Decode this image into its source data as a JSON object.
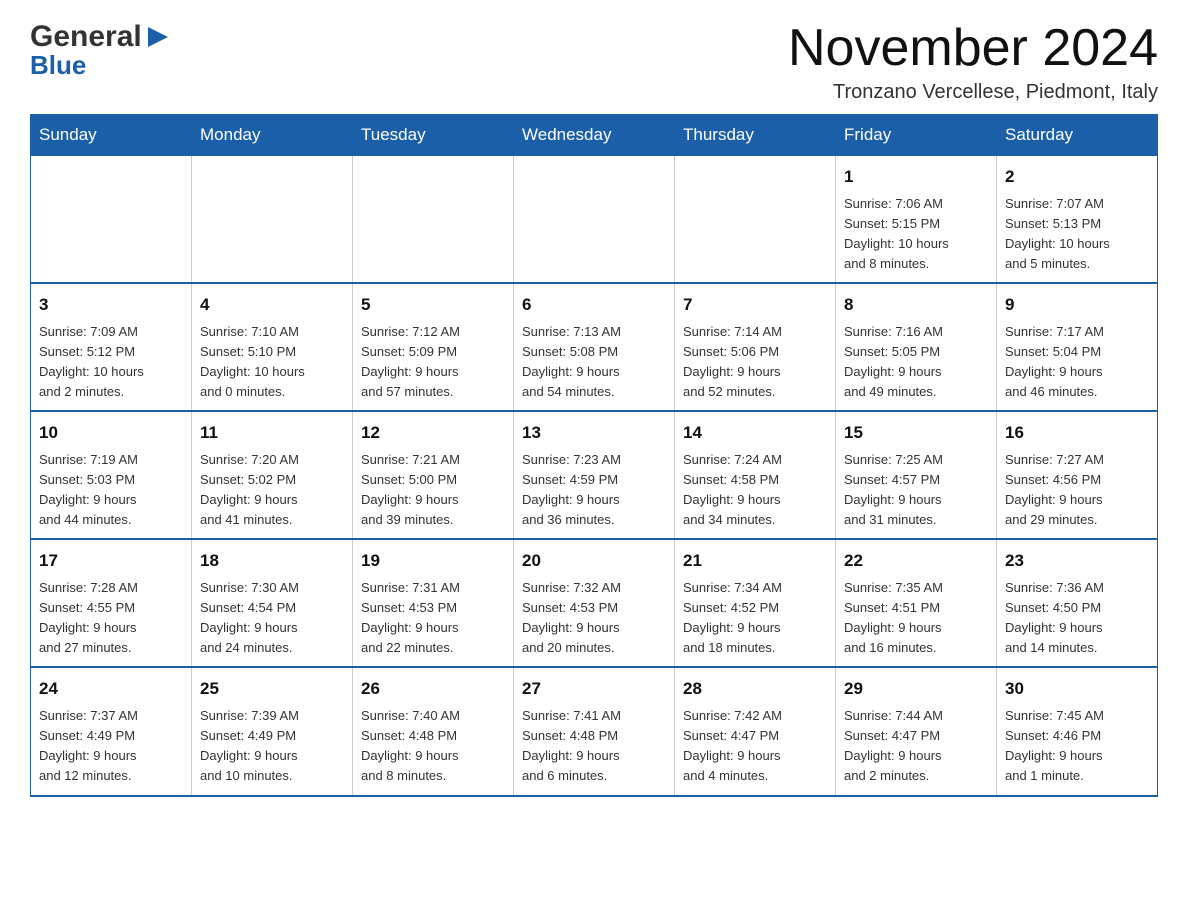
{
  "header": {
    "logo_general": "General",
    "logo_blue": "Blue",
    "month_title": "November 2024",
    "location": "Tronzano Vercellese, Piedmont, Italy"
  },
  "days_of_week": [
    "Sunday",
    "Monday",
    "Tuesday",
    "Wednesday",
    "Thursday",
    "Friday",
    "Saturday"
  ],
  "weeks": [
    {
      "cells": [
        {
          "day": "",
          "info": ""
        },
        {
          "day": "",
          "info": ""
        },
        {
          "day": "",
          "info": ""
        },
        {
          "day": "",
          "info": ""
        },
        {
          "day": "",
          "info": ""
        },
        {
          "day": "1",
          "info": "Sunrise: 7:06 AM\nSunset: 5:15 PM\nDaylight: 10 hours\nand 8 minutes."
        },
        {
          "day": "2",
          "info": "Sunrise: 7:07 AM\nSunset: 5:13 PM\nDaylight: 10 hours\nand 5 minutes."
        }
      ]
    },
    {
      "cells": [
        {
          "day": "3",
          "info": "Sunrise: 7:09 AM\nSunset: 5:12 PM\nDaylight: 10 hours\nand 2 minutes."
        },
        {
          "day": "4",
          "info": "Sunrise: 7:10 AM\nSunset: 5:10 PM\nDaylight: 10 hours\nand 0 minutes."
        },
        {
          "day": "5",
          "info": "Sunrise: 7:12 AM\nSunset: 5:09 PM\nDaylight: 9 hours\nand 57 minutes."
        },
        {
          "day": "6",
          "info": "Sunrise: 7:13 AM\nSunset: 5:08 PM\nDaylight: 9 hours\nand 54 minutes."
        },
        {
          "day": "7",
          "info": "Sunrise: 7:14 AM\nSunset: 5:06 PM\nDaylight: 9 hours\nand 52 minutes."
        },
        {
          "day": "8",
          "info": "Sunrise: 7:16 AM\nSunset: 5:05 PM\nDaylight: 9 hours\nand 49 minutes."
        },
        {
          "day": "9",
          "info": "Sunrise: 7:17 AM\nSunset: 5:04 PM\nDaylight: 9 hours\nand 46 minutes."
        }
      ]
    },
    {
      "cells": [
        {
          "day": "10",
          "info": "Sunrise: 7:19 AM\nSunset: 5:03 PM\nDaylight: 9 hours\nand 44 minutes."
        },
        {
          "day": "11",
          "info": "Sunrise: 7:20 AM\nSunset: 5:02 PM\nDaylight: 9 hours\nand 41 minutes."
        },
        {
          "day": "12",
          "info": "Sunrise: 7:21 AM\nSunset: 5:00 PM\nDaylight: 9 hours\nand 39 minutes."
        },
        {
          "day": "13",
          "info": "Sunrise: 7:23 AM\nSunset: 4:59 PM\nDaylight: 9 hours\nand 36 minutes."
        },
        {
          "day": "14",
          "info": "Sunrise: 7:24 AM\nSunset: 4:58 PM\nDaylight: 9 hours\nand 34 minutes."
        },
        {
          "day": "15",
          "info": "Sunrise: 7:25 AM\nSunset: 4:57 PM\nDaylight: 9 hours\nand 31 minutes."
        },
        {
          "day": "16",
          "info": "Sunrise: 7:27 AM\nSunset: 4:56 PM\nDaylight: 9 hours\nand 29 minutes."
        }
      ]
    },
    {
      "cells": [
        {
          "day": "17",
          "info": "Sunrise: 7:28 AM\nSunset: 4:55 PM\nDaylight: 9 hours\nand 27 minutes."
        },
        {
          "day": "18",
          "info": "Sunrise: 7:30 AM\nSunset: 4:54 PM\nDaylight: 9 hours\nand 24 minutes."
        },
        {
          "day": "19",
          "info": "Sunrise: 7:31 AM\nSunset: 4:53 PM\nDaylight: 9 hours\nand 22 minutes."
        },
        {
          "day": "20",
          "info": "Sunrise: 7:32 AM\nSunset: 4:53 PM\nDaylight: 9 hours\nand 20 minutes."
        },
        {
          "day": "21",
          "info": "Sunrise: 7:34 AM\nSunset: 4:52 PM\nDaylight: 9 hours\nand 18 minutes."
        },
        {
          "day": "22",
          "info": "Sunrise: 7:35 AM\nSunset: 4:51 PM\nDaylight: 9 hours\nand 16 minutes."
        },
        {
          "day": "23",
          "info": "Sunrise: 7:36 AM\nSunset: 4:50 PM\nDaylight: 9 hours\nand 14 minutes."
        }
      ]
    },
    {
      "cells": [
        {
          "day": "24",
          "info": "Sunrise: 7:37 AM\nSunset: 4:49 PM\nDaylight: 9 hours\nand 12 minutes."
        },
        {
          "day": "25",
          "info": "Sunrise: 7:39 AM\nSunset: 4:49 PM\nDaylight: 9 hours\nand 10 minutes."
        },
        {
          "day": "26",
          "info": "Sunrise: 7:40 AM\nSunset: 4:48 PM\nDaylight: 9 hours\nand 8 minutes."
        },
        {
          "day": "27",
          "info": "Sunrise: 7:41 AM\nSunset: 4:48 PM\nDaylight: 9 hours\nand 6 minutes."
        },
        {
          "day": "28",
          "info": "Sunrise: 7:42 AM\nSunset: 4:47 PM\nDaylight: 9 hours\nand 4 minutes."
        },
        {
          "day": "29",
          "info": "Sunrise: 7:44 AM\nSunset: 4:47 PM\nDaylight: 9 hours\nand 2 minutes."
        },
        {
          "day": "30",
          "info": "Sunrise: 7:45 AM\nSunset: 4:46 PM\nDaylight: 9 hours\nand 1 minute."
        }
      ]
    }
  ]
}
